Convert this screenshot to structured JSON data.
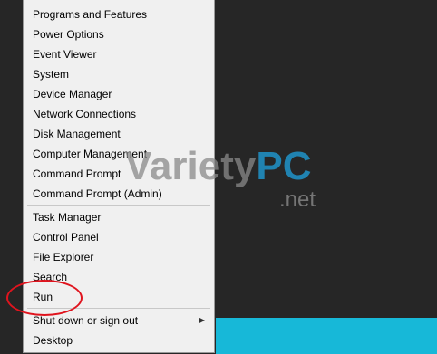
{
  "menu": {
    "items": [
      {
        "label": "Programs and Features"
      },
      {
        "label": "Power Options"
      },
      {
        "label": "Event Viewer"
      },
      {
        "label": "System"
      },
      {
        "label": "Device Manager"
      },
      {
        "label": "Network Connections"
      },
      {
        "label": "Disk Management"
      },
      {
        "label": "Computer Management"
      },
      {
        "label": "Command Prompt"
      },
      {
        "label": "Command Prompt (Admin)"
      },
      {
        "label": "Task Manager"
      },
      {
        "label": "Control Panel"
      },
      {
        "label": "File Explorer"
      },
      {
        "label": "Search"
      },
      {
        "label": "Run"
      },
      {
        "label": "Shut down or sign out"
      },
      {
        "label": "Desktop"
      }
    ],
    "submenu_arrow": "▶"
  },
  "watermark": {
    "brand": "VarietyPC",
    "domain": ".net",
    "colors": {
      "brand": "#8a8a8a",
      "pc": "#1fa3e0"
    }
  },
  "annotation": {
    "color": "#e0141e",
    "target": "Run"
  },
  "colors": {
    "menu_bg": "#f0f0f0",
    "desktop_bg": "#262626",
    "taskbar": "#17b8d8"
  }
}
